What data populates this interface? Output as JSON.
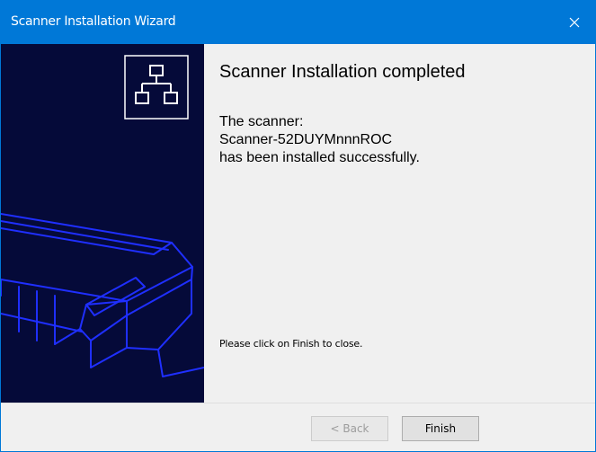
{
  "window": {
    "title": "Scanner Installation Wizard"
  },
  "icons": {
    "close": "close-icon",
    "network": "network-icon"
  },
  "content": {
    "heading": "Scanner Installation completed",
    "line1": "The scanner:",
    "scanner_name": "Scanner-52DUYMnnnROC",
    "line3": "has been installed successfully.",
    "hint": "Please click on Finish to close."
  },
  "buttons": {
    "back": "< Back",
    "finish": "Finish",
    "back_enabled": false
  },
  "colors": {
    "titlebar": "#0078d7",
    "sidebar": "#050a39",
    "illustration": "#1f2fff"
  }
}
